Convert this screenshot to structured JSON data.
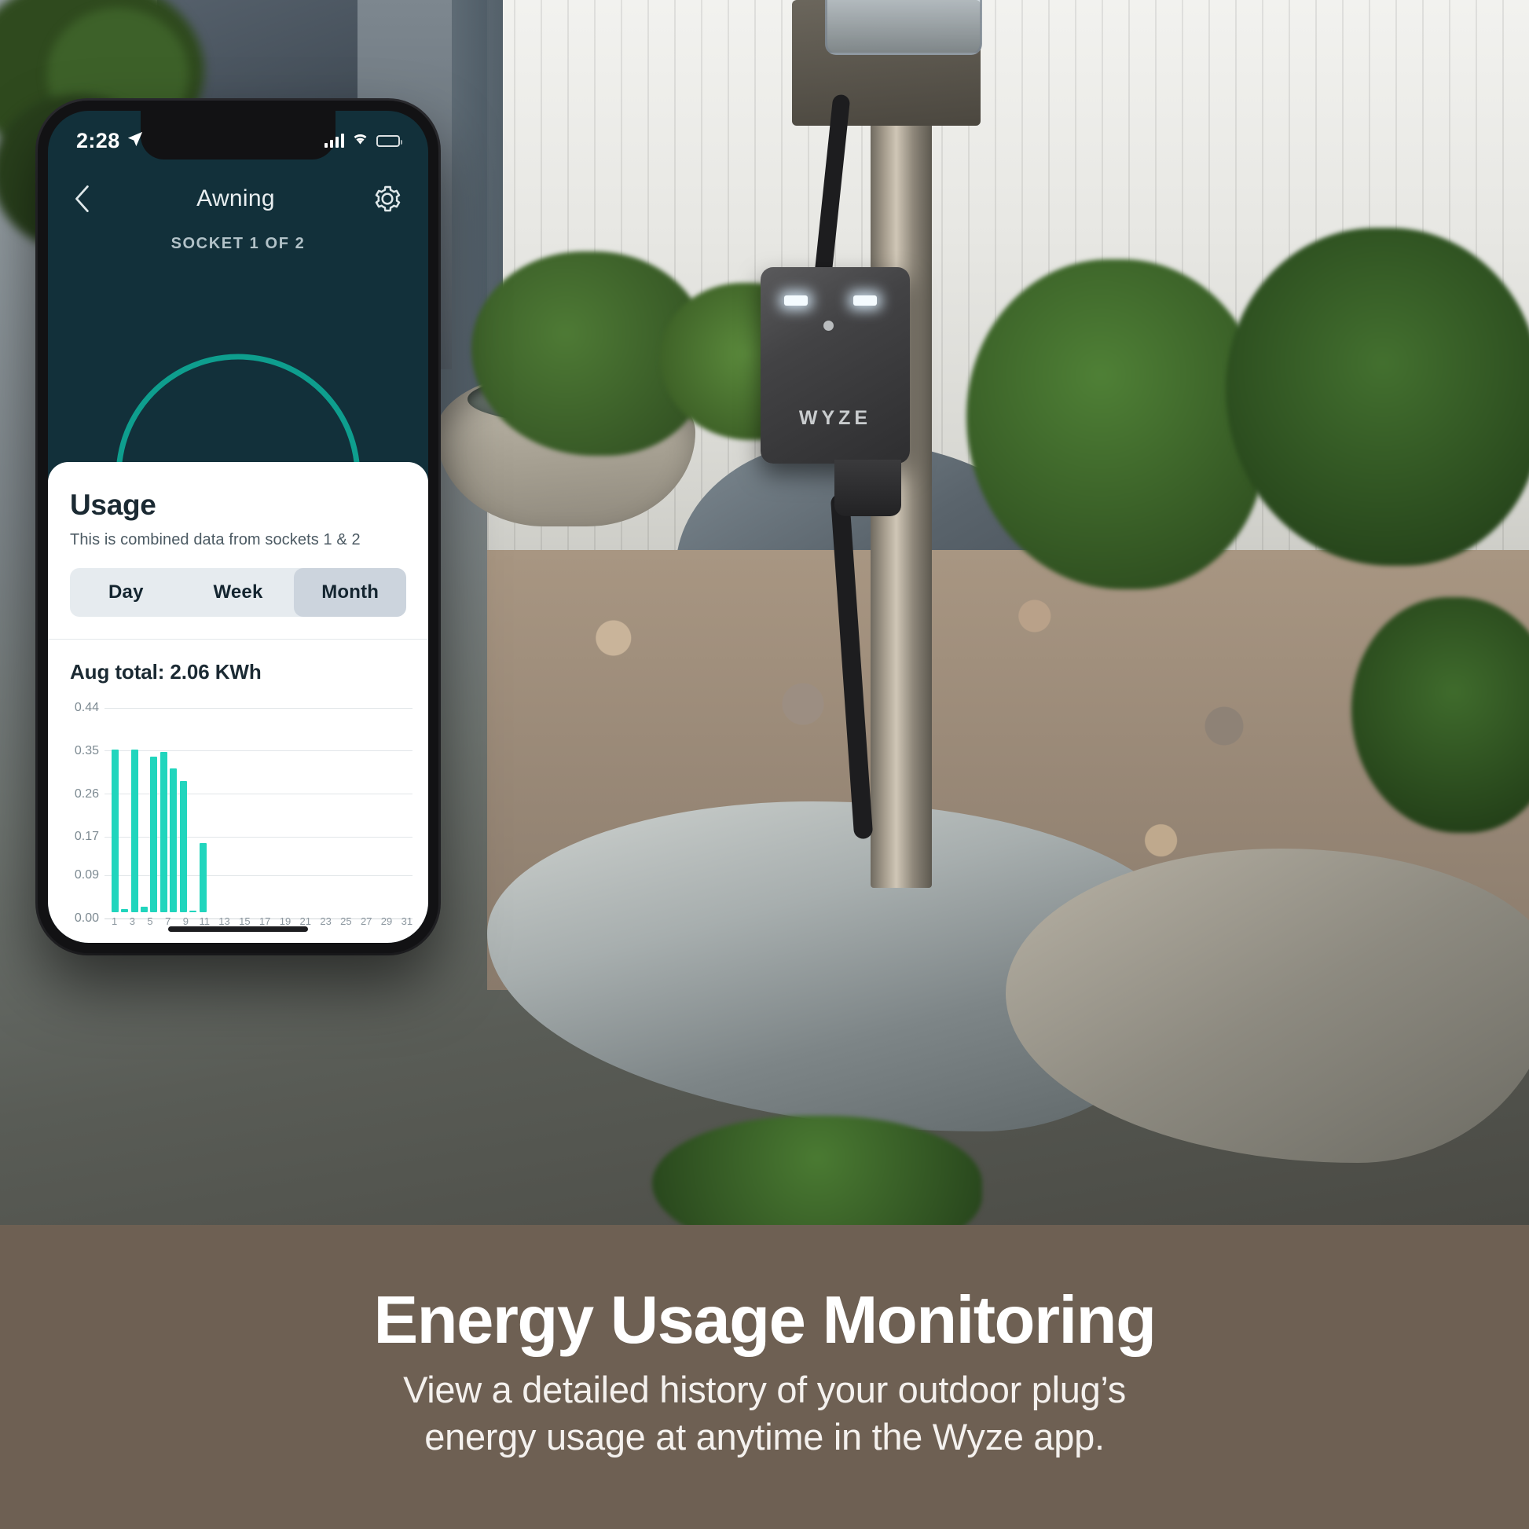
{
  "phone": {
    "status_bar": {
      "time": "2:28",
      "location_icon": "location-arrow-icon",
      "signal_icon": "cellular-signal-icon",
      "wifi_icon": "wifi-icon",
      "battery_icon": "battery-icon"
    },
    "nav": {
      "back_icon": "chevron-left-icon",
      "title": "Awning",
      "settings_icon": "gear-icon"
    },
    "socket_label": "SOCKET 1 OF 2"
  },
  "card": {
    "title": "Usage",
    "subtitle": "This is combined data from sockets 1 & 2",
    "tabs": [
      {
        "label": "Day",
        "active": false
      },
      {
        "label": "Week",
        "active": false
      },
      {
        "label": "Month",
        "active": true
      }
    ],
    "total": "Aug total: 2.06 KWh"
  },
  "chart_data": {
    "type": "bar",
    "title": "Aug total: 2.06 KWh",
    "xlabel": "",
    "ylabel": "",
    "ylim": [
      0,
      0.44
    ],
    "grid": true,
    "legend": "none",
    "bar_color": "#21d5bd",
    "ytick_labels": [
      "0.44",
      "0.35",
      "0.26",
      "0.17",
      "0.09",
      "0.00"
    ],
    "ytick_values": [
      0.44,
      0.35,
      0.26,
      0.17,
      0.09,
      0.0
    ],
    "xtick_labels": [
      "1",
      "3",
      "5",
      "7",
      "9",
      "11",
      "13",
      "15",
      "17",
      "19",
      "21",
      "23",
      "25",
      "27",
      "29",
      "31"
    ],
    "categories": [
      "1",
      "2",
      "3",
      "4",
      "5",
      "6",
      "7",
      "8",
      "9",
      "10",
      "11",
      "12",
      "13",
      "14",
      "15",
      "16",
      "17",
      "18",
      "19",
      "20",
      "21",
      "22",
      "23",
      "24",
      "25",
      "26",
      "27",
      "28",
      "29",
      "30",
      "31"
    ],
    "values": [
      0.34,
      0.006,
      0.34,
      0.012,
      0.325,
      0.335,
      0.3,
      0.275,
      0.004,
      0.145,
      0,
      0,
      0,
      0,
      0,
      0,
      0,
      0,
      0,
      0,
      0,
      0,
      0,
      0,
      0,
      0,
      0,
      0,
      0,
      0,
      0
    ]
  },
  "banner": {
    "title": "Energy Usage Monitoring",
    "subtitle_line1": "View a detailed history of your outdoor plug’s",
    "subtitle_line2": "energy usage at anytime in the Wyze app."
  },
  "device": {
    "brand": "WYZE"
  },
  "colors": {
    "accent_teal": "#21d5bd",
    "arc_teal": "#0e9e8e",
    "screen_bg": "#12303a",
    "banner_bg": "#6e6053"
  }
}
